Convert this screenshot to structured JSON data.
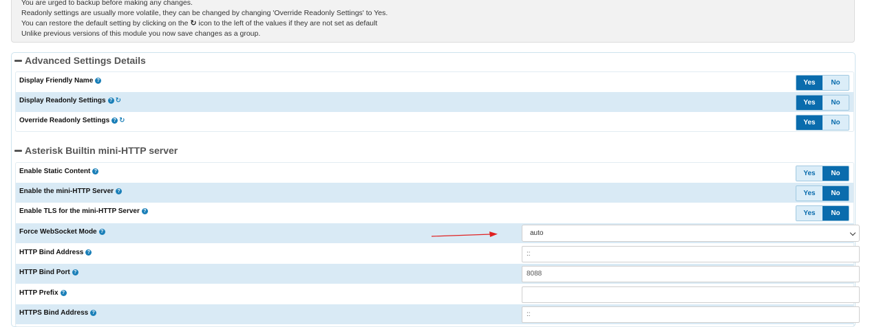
{
  "info": {
    "lines": [
      "You are urged to backup before making any changes.",
      "Readonly settings are usually more volatile, they can be changed by changing 'Override Readonly Settings' to Yes.",
      "You can restore the default setting by clicking on the",
      "icon to the left of the values if they are not set as default",
      "Unlike previous versions of this module you now save changes as a group."
    ]
  },
  "sections": {
    "advanced": {
      "title": "Advanced Settings Details",
      "rows": [
        {
          "label": "Display Friendly Name",
          "value": "Yes"
        },
        {
          "label": "Display Readonly Settings",
          "value": "Yes"
        },
        {
          "label": "Override Readonly Settings",
          "value": "Yes"
        }
      ]
    },
    "http": {
      "title": "Asterisk Builtin mini-HTTP server",
      "rows": [
        {
          "label": "Enable Static Content",
          "value": "No"
        },
        {
          "label": "Enable the mini-HTTP Server",
          "value": "No"
        },
        {
          "label": "Enable TLS for the mini-HTTP Server",
          "value": "No"
        },
        {
          "label": "Force WebSocket Mode",
          "value": "auto"
        },
        {
          "label": "HTTP Bind Address",
          "value": "::"
        },
        {
          "label": "HTTP Bind Port",
          "value": "8088"
        },
        {
          "label": "HTTP Prefix",
          "value": ""
        },
        {
          "label": "HTTPS Bind Address",
          "value": "::"
        }
      ]
    }
  },
  "toggle": {
    "yes": "Yes",
    "no": "No"
  },
  "colors": {
    "accent": "#0a6cad",
    "row_shade": "#d9eaf5",
    "annotation_arrow": "#e02020"
  },
  "icons": {
    "help": "question-circle-icon",
    "reset": "refresh-icon",
    "collapse": "minus-icon"
  }
}
